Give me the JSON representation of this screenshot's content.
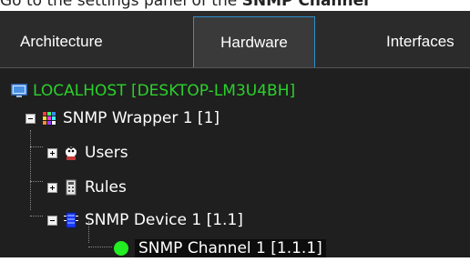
{
  "instruction": {
    "prefix": "Go to the settings panel of the ",
    "bold": "SNMP Channel"
  },
  "tabs": [
    {
      "label": "Architecture"
    },
    {
      "label": "Hardware"
    },
    {
      "label": "Interfaces"
    }
  ],
  "tree": {
    "root": {
      "label": "LOCALHOST [DESKTOP-LM3U4BH]",
      "icon": "computer-icon"
    },
    "wrapper": {
      "label": "SNMP Wrapper 1 [1]",
      "icon": "snmp-wrapper-icon"
    },
    "users": {
      "label": "Users",
      "icon": "users-icon"
    },
    "rules": {
      "label": "Rules",
      "icon": "rules-icon"
    },
    "device": {
      "label": "SNMP Device 1 [1.1]",
      "icon": "snmp-device-icon"
    },
    "channel": {
      "label": "SNMP Channel 1 [1.1.1]",
      "icon": "green-status-icon"
    }
  },
  "colors": {
    "root_text": "#2bd12b",
    "active_tab_border": "#2f8fd0",
    "status_green": "#22ee22"
  }
}
